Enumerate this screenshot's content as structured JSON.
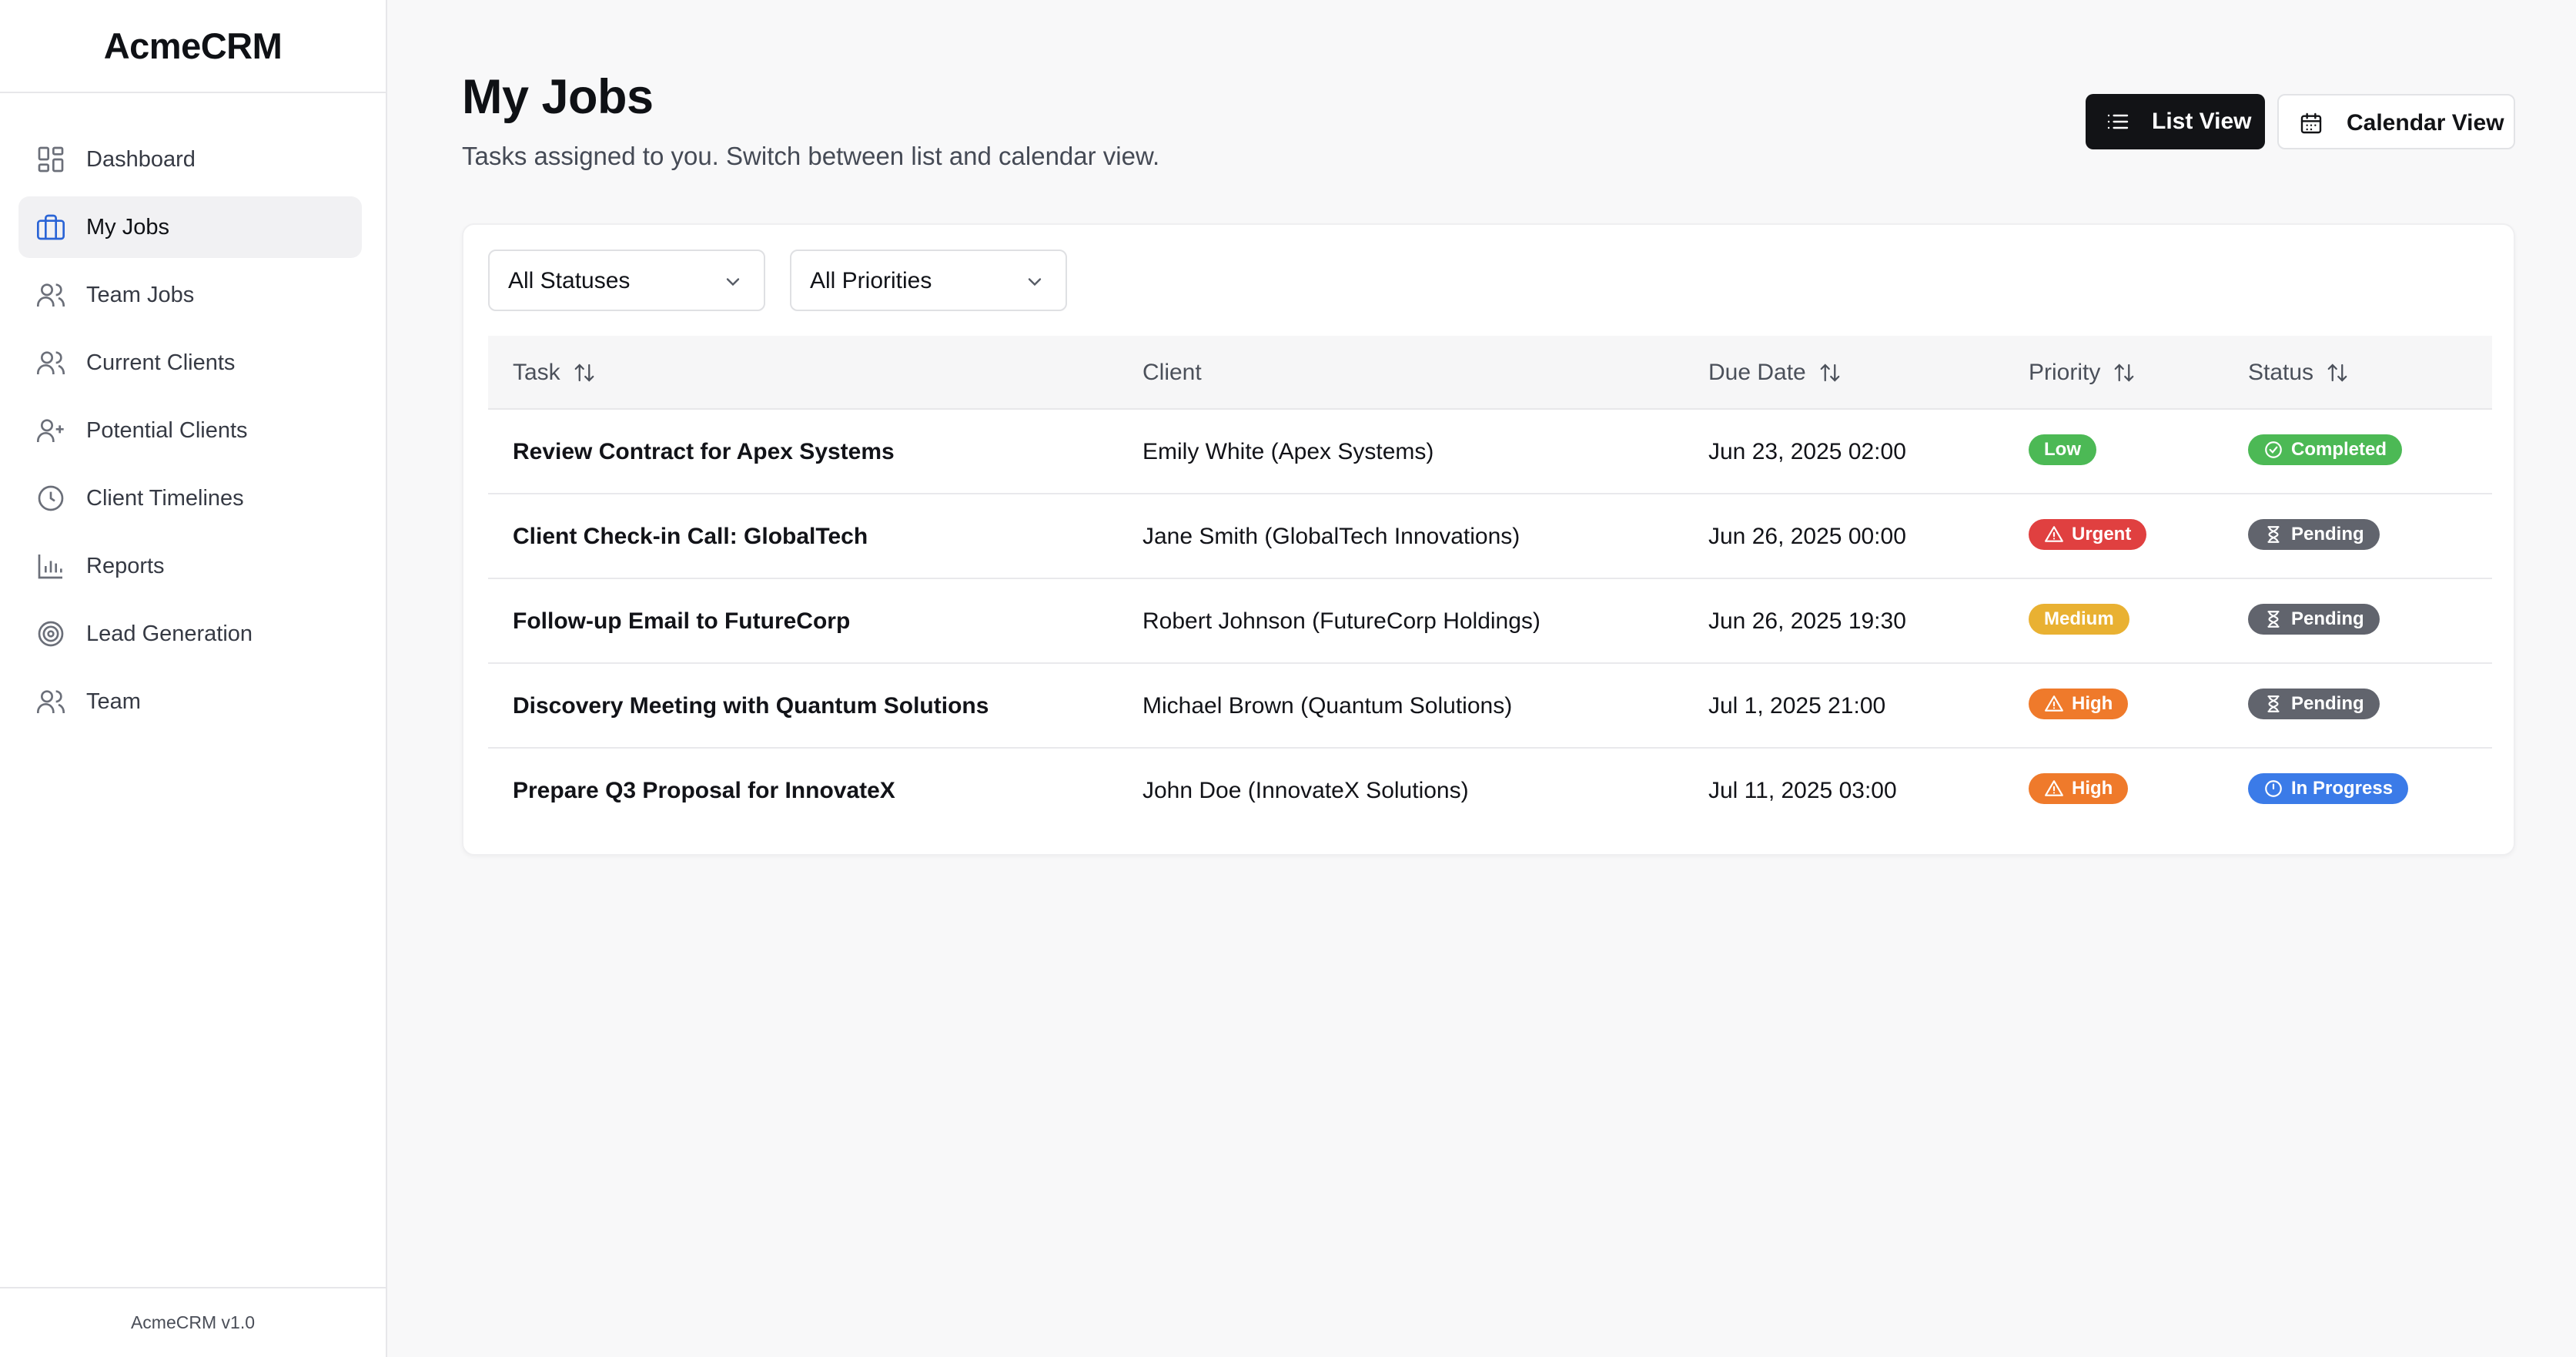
{
  "app": {
    "name": "AcmeCRM",
    "version": "AcmeCRM v1.0"
  },
  "sidebar": {
    "items": [
      {
        "label": "Dashboard",
        "icon": "dashboard-icon",
        "active": false
      },
      {
        "label": "My Jobs",
        "icon": "briefcase-icon",
        "active": true
      },
      {
        "label": "Team Jobs",
        "icon": "users-icon",
        "active": false
      },
      {
        "label": "Current Clients",
        "icon": "users-icon",
        "active": false
      },
      {
        "label": "Potential Clients",
        "icon": "user-plus-icon",
        "active": false
      },
      {
        "label": "Client Timelines",
        "icon": "clock-icon",
        "active": false
      },
      {
        "label": "Reports",
        "icon": "bar-chart-icon",
        "active": false
      },
      {
        "label": "Lead Generation",
        "icon": "target-icon",
        "active": false
      },
      {
        "label": "Team",
        "icon": "users-icon",
        "active": false
      }
    ]
  },
  "header": {
    "title": "My Jobs",
    "subtitle": "Tasks assigned to you. Switch between list and calendar view.",
    "list_view_label": "List View",
    "calendar_view_label": "Calendar View"
  },
  "filters": {
    "status": "All Statuses",
    "priority": "All Priorities"
  },
  "table": {
    "headers": {
      "task": "Task",
      "client": "Client",
      "due_date": "Due Date",
      "priority": "Priority",
      "status": "Status"
    },
    "rows": [
      {
        "task": "Review Contract for Apex Systems",
        "client": "Emily White (Apex Systems)",
        "due": "Jun 23, 2025 02:00",
        "priority": "Low",
        "status": "Completed"
      },
      {
        "task": "Client Check-in Call: GlobalTech",
        "client": "Jane Smith (GlobalTech Innovations)",
        "due": "Jun 26, 2025 00:00",
        "priority": "Urgent",
        "status": "Pending"
      },
      {
        "task": "Follow-up Email to FutureCorp",
        "client": "Robert Johnson (FutureCorp Holdings)",
        "due": "Jun 26, 2025 19:30",
        "priority": "Medium",
        "status": "Pending"
      },
      {
        "task": "Discovery Meeting with Quantum Solutions",
        "client": "Michael Brown (Quantum Solutions)",
        "due": "Jul 1, 2025 21:00",
        "priority": "High",
        "status": "Pending"
      },
      {
        "task": "Prepare Q3 Proposal for InnovateX",
        "client": "John Doe (InnovateX Solutions)",
        "due": "Jul 11, 2025 03:00",
        "priority": "High",
        "status": "In Progress"
      }
    ]
  },
  "colors": {
    "low": "#4cb955",
    "urgent": "#e04040",
    "medium": "#e9b132",
    "high": "#ef7a2b",
    "completed": "#4cb955",
    "pending": "#61646d",
    "in_progress": "#3b7be8"
  }
}
